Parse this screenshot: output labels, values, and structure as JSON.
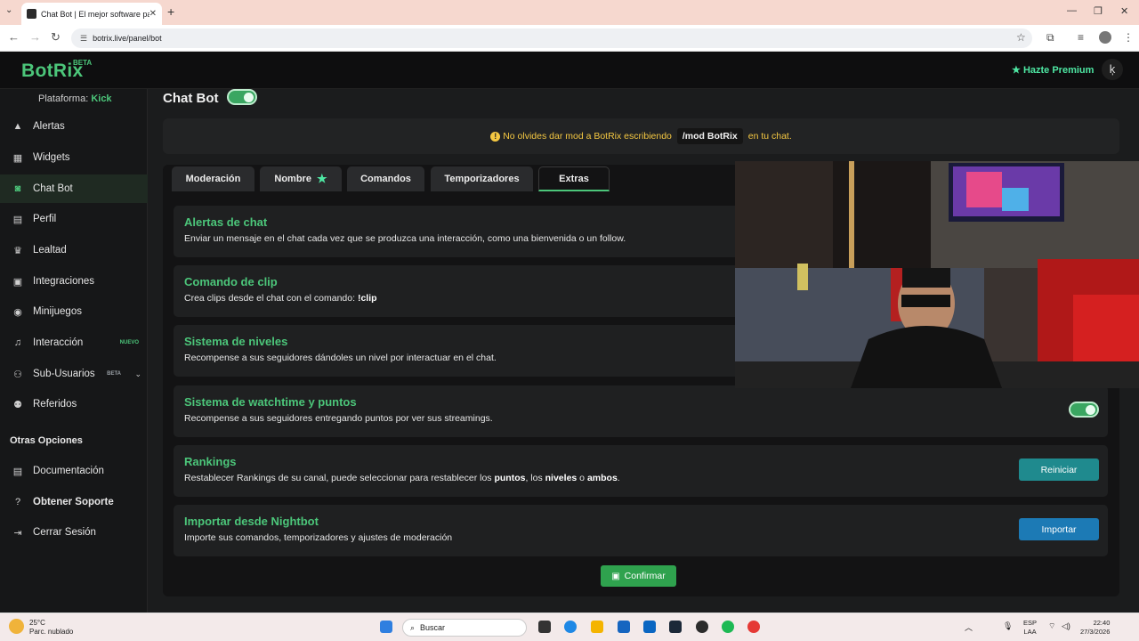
{
  "browser": {
    "tab_title": "Chat Bot | El mejor software pa",
    "url": "botrix.live/panel/bot"
  },
  "header": {
    "logo": "BotRix",
    "logo_badge": "BETA",
    "premium_label": "Hazte Premium"
  },
  "sidebar": {
    "platform_label": "Plataforma:",
    "platform_value": "Kick",
    "items": [
      {
        "label": "Alertas",
        "icon": "warning-icon"
      },
      {
        "label": "Widgets",
        "icon": "widgets-icon"
      },
      {
        "label": "Chat Bot",
        "icon": "robot-icon",
        "active": true
      },
      {
        "label": "Perfil",
        "icon": "id-card-icon"
      },
      {
        "label": "Lealtad",
        "icon": "trophy-icon"
      },
      {
        "label": "Integraciones",
        "icon": "integrations-icon"
      },
      {
        "label": "Minijuegos",
        "icon": "gamepad-icon"
      },
      {
        "label": "Interacción",
        "icon": "music-icon",
        "badge": "NUEVO"
      },
      {
        "label": "Sub-Usuarios",
        "icon": "users-icon",
        "badge": "BETA"
      },
      {
        "label": "Referidos",
        "icon": "referrals-icon"
      }
    ],
    "section_title": "Otras Opciones",
    "other_items": [
      {
        "label": "Documentación",
        "icon": "document-icon"
      },
      {
        "label": "Obtener Soporte",
        "icon": "help-icon"
      },
      {
        "label": "Cerrar Sesión",
        "icon": "logout-icon"
      }
    ]
  },
  "main": {
    "title": "Chat Bot",
    "notice_before": "No olvides dar mod a BotRix escribiendo",
    "notice_code": "/mod BotRix",
    "notice_after": "en tu chat.",
    "tabs": [
      "Moderación",
      "Nombre",
      "Comandos",
      "Temporizadores",
      "Extras"
    ],
    "active_tab": "Extras",
    "cards": [
      {
        "title": "Alertas de chat",
        "desc": "Enviar un mensaje en el chat cada vez que se produzca una interacción, como una bienvenida o un follow."
      },
      {
        "title": "Comando de clip",
        "desc_before": "Crea clips desde el chat con el comando:",
        "desc_bold": "!clip"
      },
      {
        "title": "Sistema de niveles",
        "desc": "Recompense a sus seguidores dándoles un nivel por interactuar en el chat."
      },
      {
        "title": "Sistema de watchtime y puntos",
        "desc": "Recompense a sus seguidores entregando puntos por ver sus streamings.",
        "enabled": true
      },
      {
        "title": "Rankings",
        "desc_before": "Restablecer Rankings de su canal, puede seleccionar para restablecer los",
        "desc_b1": "puntos",
        "desc_mid1": ", los",
        "desc_b2": "niveles",
        "desc_mid2": "o",
        "desc_b3": "ambos",
        "desc_end": ".",
        "button": "Reiniciar"
      },
      {
        "title": "Importar desde Nightbot",
        "desc": "Importe sus comandos, temporizadores y ajustes de moderación",
        "button": "Importar"
      }
    ],
    "confirm_label": "Confirmar"
  },
  "taskbar": {
    "temperature": "25°C",
    "weather": "Parc. nublado",
    "search_placeholder": "Buscar",
    "lang": "ESP",
    "lang_sub": "LAA",
    "time": "22:40",
    "date": "27/3/2026"
  },
  "colors": {
    "accent_green": "#4cc67a",
    "premium": "#4ee7a3",
    "notice": "#f5c842",
    "reiniciar": "#1f8a8e",
    "importar": "#1c7ab5"
  }
}
